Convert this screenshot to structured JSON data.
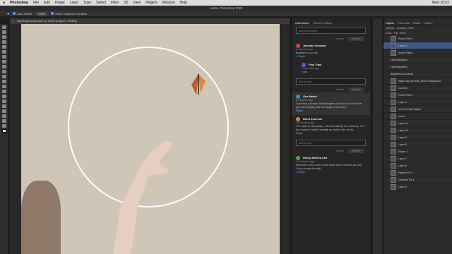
{
  "menubar": {
    "app": "Photoshop",
    "items": [
      "File",
      "Edit",
      "Image",
      "Layer",
      "Type",
      "Select",
      "Filter",
      "3D",
      "View",
      "Plugins",
      "Window",
      "Help"
    ],
    "clock": "Wed 10:02"
  },
  "window": {
    "title": "Adobe Photoshop 2022"
  },
  "options": {
    "auto_select": "Auto-Select:",
    "layer_sel": "Layer",
    "transform": "Show Transform Controls"
  },
  "document": {
    "tab": "NewBeginnings.psdc @ 100% (Layer 5, RGB/8)"
  },
  "comments": {
    "tabs": [
      "Comments",
      "Version History"
    ],
    "add_placeholder": "Add a comment...",
    "cancel": "Cancel",
    "submit": "Submit",
    "items": [
      {
        "name": "Jasmine Gonzalez",
        "time": "6 minutes ago",
        "text": "Brighten it up a bit.",
        "reply": "1 Reply"
      },
      {
        "name": "Paul Trani",
        "time": "5 seconds ago",
        "text": "I will"
      },
      {
        "name": "Gus Martin",
        "time": "8 minutes ago",
        "text": "I love this concept. Michelangelo would be proud! Have you tried playing with the angle of the arm?",
        "reply": "Reply"
      },
      {
        "name": "Brent Emerson",
        "time": "10 minutes ago",
        "text": "The hand is very sharp, but the butterfly is a bit fuzzy. The fuzz doesn't really translate as motion blur to me.",
        "reply": "Reply"
      },
      {
        "name": "Rocky Montez-Carr",
        "time": "12 minutes ago",
        "text": "Would be cool to see some other color versions as well. Cool concept though.",
        "reply": "1 Reply"
      }
    ],
    "reply_placeholder": "Add a reply..."
  },
  "panels": {
    "tabs": [
      "Layers",
      "Channels",
      "Paths",
      "History"
    ],
    "blend": "Normal",
    "opacity": "Opacity: 100%",
    "fill": "Fill: 100%",
    "lock": "Lock:",
    "layers": [
      "Photo Filter 1",
      "Layer 5",
      "Smart Filters",
      "Hue/Saturation",
      "Hue/Saturation",
      "Brightness/Contrast",
      "Right way arm test_alone background",
      "Curves 1",
      "Photo Filter 1",
      "Layer 1",
      "Vector Smart Object",
      "moon",
      "Layer 11",
      "Layer 10",
      "Layer 9",
      "Layer 8",
      "Ellipse 1",
      "Layer 7",
      "Layer 6",
      "Pattern Fill 1",
      "Gradient Fill 1",
      "Layer 0"
    ]
  }
}
